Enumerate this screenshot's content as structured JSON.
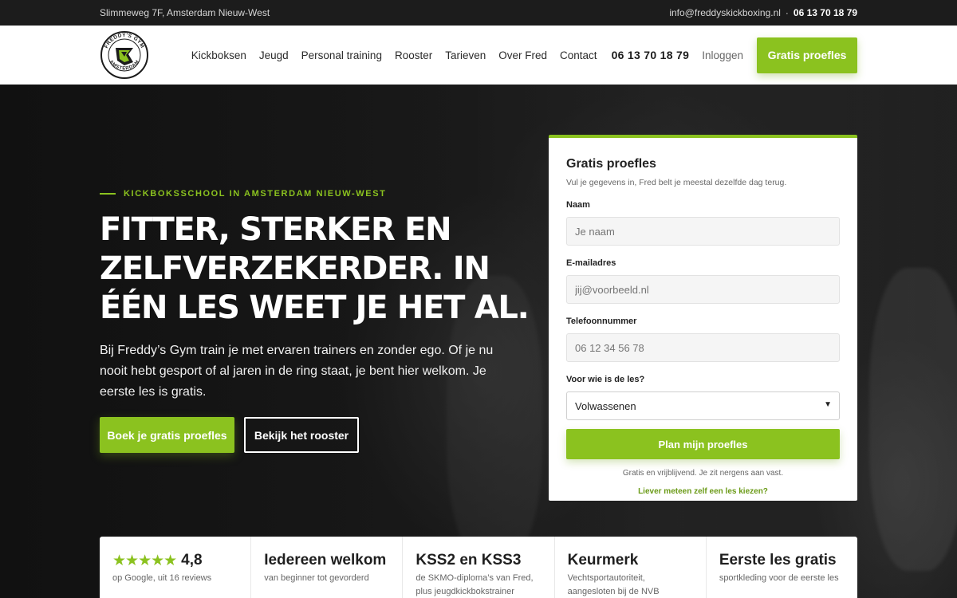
{
  "topbar": {
    "address": "Slimmeweg 7F, Amsterdam Nieuw-West",
    "email": "info@freddyskickboxing.nl",
    "separator": "·",
    "phone": "06 13 70 18 79"
  },
  "nav": {
    "logo_text_top": "FREDDY'S GYM",
    "logo_text_bottom": "AMSTERDAM",
    "items": [
      "Kickboksen",
      "Jeugd",
      "Personal training",
      "Rooster",
      "Tarieven",
      "Over Fred",
      "Contact"
    ],
    "phone": "06 13 70 18 79",
    "login": "Inloggen",
    "cta": "Gratis proefles"
  },
  "hero": {
    "eyebrow": "KICKBOKSSCHOOL IN AMSTERDAM NIEUW-WEST",
    "headline": "FITTER, STERKER EN ZELFVERZEKERDER. IN ÉÉN LES WEET JE HET AL.",
    "lead": "Bij Freddy’s Gym train je met ervaren trainers en zonder ego. Of je nu nooit hebt gesport of al jaren in de ring staat, je bent hier welkom. Je eerste les is gratis.",
    "primary_button": "Boek je gratis proefles",
    "secondary_button": "Bekijk het rooster"
  },
  "form": {
    "title": "Gratis proefles",
    "subtitle": "Vul je gegevens in, Fred belt je meestal dezelfde dag terug.",
    "name_label": "Naam",
    "name_placeholder": "Je naam",
    "email_label": "E-mailadres",
    "email_placeholder": "jij@voorbeeld.nl",
    "phone_label": "Telefoonnummer",
    "phone_placeholder": "06 12 34 56 78",
    "who_label": "Voor wie is de les?",
    "who_selected": "Volwassenen",
    "submit": "Plan mijn proefles",
    "note": "Gratis en vrijblijvend. Je zit nergens aan vast.",
    "alt_link": "Liever meteen zelf een les kiezen?"
  },
  "stats": [
    {
      "big": "4,8",
      "stars": "★★★★★",
      "small": "op Google, uit 16 reviews"
    },
    {
      "big": "Iedereen welkom",
      "small": "van beginner tot gevorderd"
    },
    {
      "big": "KSS2 en KSS3",
      "small": "de SKMO-diploma’s van Fred, plus jeugdkickbokstrainer"
    },
    {
      "big": "Keurmerk",
      "small": "Vechtsportautoriteit, aangesloten bij de NVB"
    },
    {
      "big": "Eerste les gratis",
      "small": "sportkleding voor de eerste les"
    }
  ],
  "colors": {
    "accent": "#8bc21f",
    "dark": "#1c1c1c"
  }
}
